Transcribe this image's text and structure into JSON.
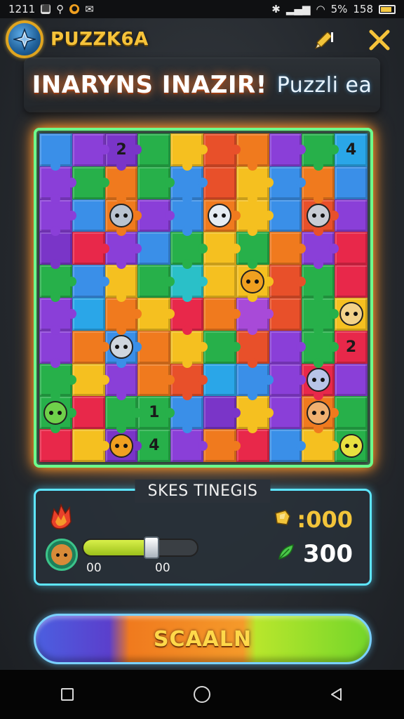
{
  "status_bar": {
    "time": "1211",
    "battery_percent": "5%",
    "battery_extra": "158"
  },
  "header": {
    "app_name": "PUZZK6A",
    "logo_icon": "compass-star-icon",
    "edit_icon": "pencil-icon",
    "close_icon": "close-icon"
  },
  "banner": {
    "main_text": "INARYNS INAZIR!",
    "sub_text": "Puzzli ea"
  },
  "board": {
    "pieces": [
      {
        "c": "#3a8fe8",
        "g": ""
      },
      {
        "c": "#8a3fd8",
        "g": ""
      },
      {
        "c": "#7a35c8",
        "g": "2"
      },
      {
        "c": "#27b04a",
        "g": ""
      },
      {
        "c": "#f5c020",
        "g": ""
      },
      {
        "c": "#e8502a",
        "g": ""
      },
      {
        "c": "#f07a1e",
        "g": ""
      },
      {
        "c": "#8a3fd8",
        "g": ""
      },
      {
        "c": "#27b04a",
        "g": ""
      },
      {
        "c": "#2aa6e8",
        "g": "4"
      },
      {
        "c": "#8a3fd8",
        "g": ""
      },
      {
        "c": "#27b04a",
        "g": ""
      },
      {
        "c": "#f07a1e",
        "g": ""
      },
      {
        "c": "#27b04a",
        "g": ""
      },
      {
        "c": "#3a8fe8",
        "g": ""
      },
      {
        "c": "#e8502a",
        "g": ""
      },
      {
        "c": "#f5c020",
        "g": ""
      },
      {
        "c": "#3a8fe8",
        "g": ""
      },
      {
        "c": "#f07a1e",
        "g": ""
      },
      {
        "c": "#3a8fe8",
        "g": ""
      },
      {
        "c": "#8a3fd8",
        "g": ""
      },
      {
        "c": "#3a8fe8",
        "g": ""
      },
      {
        "c": "#f07a1e",
        "g": "",
        "creature": "#b9c3d0"
      },
      {
        "c": "#8a3fd8",
        "g": ""
      },
      {
        "c": "#3a8fe8",
        "g": ""
      },
      {
        "c": "#f07a1e",
        "g": "",
        "creature": "#e6ecf2"
      },
      {
        "c": "#f5c020",
        "g": ""
      },
      {
        "c": "#3a8fe8",
        "g": ""
      },
      {
        "c": "#e8502a",
        "g": "",
        "creature": "#c8ccd4"
      },
      {
        "c": "#8a3fd8",
        "g": ""
      },
      {
        "c": "#7a35c8",
        "g": ""
      },
      {
        "c": "#e8284a",
        "g": ""
      },
      {
        "c": "#8a3fd8",
        "g": ""
      },
      {
        "c": "#3a8fe8",
        "g": ""
      },
      {
        "c": "#27b04a",
        "g": ""
      },
      {
        "c": "#f5c020",
        "g": ""
      },
      {
        "c": "#27b04a",
        "g": ""
      },
      {
        "c": "#f07a1e",
        "g": ""
      },
      {
        "c": "#8a3fd8",
        "g": ""
      },
      {
        "c": "#e8284a",
        "g": ""
      },
      {
        "c": "#27b04a",
        "g": ""
      },
      {
        "c": "#3a8fe8",
        "g": ""
      },
      {
        "c": "#f5c020",
        "g": ""
      },
      {
        "c": "#27b04a",
        "g": ""
      },
      {
        "c": "#2ac0c8",
        "g": ""
      },
      {
        "c": "#f5c020",
        "g": ""
      },
      {
        "c": "#f5c020",
        "g": "",
        "creature": "#f0a020"
      },
      {
        "c": "#e8502a",
        "g": ""
      },
      {
        "c": "#27b04a",
        "g": ""
      },
      {
        "c": "#e8284a",
        "g": ""
      },
      {
        "c": "#8a3fd8",
        "g": ""
      },
      {
        "c": "#2aa6e8",
        "g": ""
      },
      {
        "c": "#f07a1e",
        "g": ""
      },
      {
        "c": "#f5c020",
        "g": ""
      },
      {
        "c": "#e8284a",
        "g": ""
      },
      {
        "c": "#f07a1e",
        "g": ""
      },
      {
        "c": "#a84ad8",
        "g": ""
      },
      {
        "c": "#e8502a",
        "g": ""
      },
      {
        "c": "#27b04a",
        "g": ""
      },
      {
        "c": "#f5c020",
        "g": "",
        "creature": "#f2d28a"
      },
      {
        "c": "#8a3fd8",
        "g": ""
      },
      {
        "c": "#f07a1e",
        "g": ""
      },
      {
        "c": "#3a8fe8",
        "g": "",
        "creature": "#cfd6de"
      },
      {
        "c": "#f07a1e",
        "g": ""
      },
      {
        "c": "#f5c020",
        "g": ""
      },
      {
        "c": "#27b04a",
        "g": ""
      },
      {
        "c": "#e8502a",
        "g": ""
      },
      {
        "c": "#8a3fd8",
        "g": ""
      },
      {
        "c": "#27b04a",
        "g": ""
      },
      {
        "c": "#e8284a",
        "g": "2"
      },
      {
        "c": "#27b04a",
        "g": ""
      },
      {
        "c": "#f5c020",
        "g": ""
      },
      {
        "c": "#8a3fd8",
        "g": ""
      },
      {
        "c": "#f07a1e",
        "g": ""
      },
      {
        "c": "#e8502a",
        "g": ""
      },
      {
        "c": "#2aa6e8",
        "g": ""
      },
      {
        "c": "#3a8fe8",
        "g": ""
      },
      {
        "c": "#8a3fd8",
        "g": ""
      },
      {
        "c": "#e8284a",
        "g": "",
        "creature": "#b8c4e8"
      },
      {
        "c": "#8a3fd8",
        "g": ""
      },
      {
        "c": "#27b04a",
        "g": "",
        "creature": "#6fd04a"
      },
      {
        "c": "#e8284a",
        "g": ""
      },
      {
        "c": "#27b04a",
        "g": ""
      },
      {
        "c": "#27b04a",
        "g": "1"
      },
      {
        "c": "#3a8fe8",
        "g": ""
      },
      {
        "c": "#7a35c8",
        "g": ""
      },
      {
        "c": "#f5c020",
        "g": ""
      },
      {
        "c": "#8a3fd8",
        "g": ""
      },
      {
        "c": "#f07a1e",
        "g": "",
        "creature": "#f0b070"
      },
      {
        "c": "#27b04a",
        "g": ""
      },
      {
        "c": "#e8284a",
        "g": ""
      },
      {
        "c": "#f5c020",
        "g": ""
      },
      {
        "c": "#7a35c8",
        "g": "",
        "creature": "#f0a020"
      },
      {
        "c": "#27b04a",
        "g": "4"
      },
      {
        "c": "#8a3fd8",
        "g": ""
      },
      {
        "c": "#f07a1e",
        "g": ""
      },
      {
        "c": "#e8284a",
        "g": ""
      },
      {
        "c": "#3a8fe8",
        "g": ""
      },
      {
        "c": "#f5c020",
        "g": ""
      },
      {
        "c": "#27b04a",
        "g": "",
        "creature": "#e8e040"
      }
    ]
  },
  "stats": {
    "title": "SKES TINEGIS",
    "bolt_value": ":000",
    "leaf_value": "300",
    "progress_fraction": 0.6,
    "progress_left_label": "00",
    "progress_right_label": "00",
    "flame_icon": "flame-icon",
    "bolt_icon": "bolt-icon",
    "leaf_icon": "leaf-icon"
  },
  "action_button": {
    "label": "SCAALN"
  },
  "colors": {
    "board_border": "#6cff8c",
    "board_glow": "#ff9a2a",
    "stats_border": "#5ee6ff",
    "gold": "#f6c33a"
  }
}
